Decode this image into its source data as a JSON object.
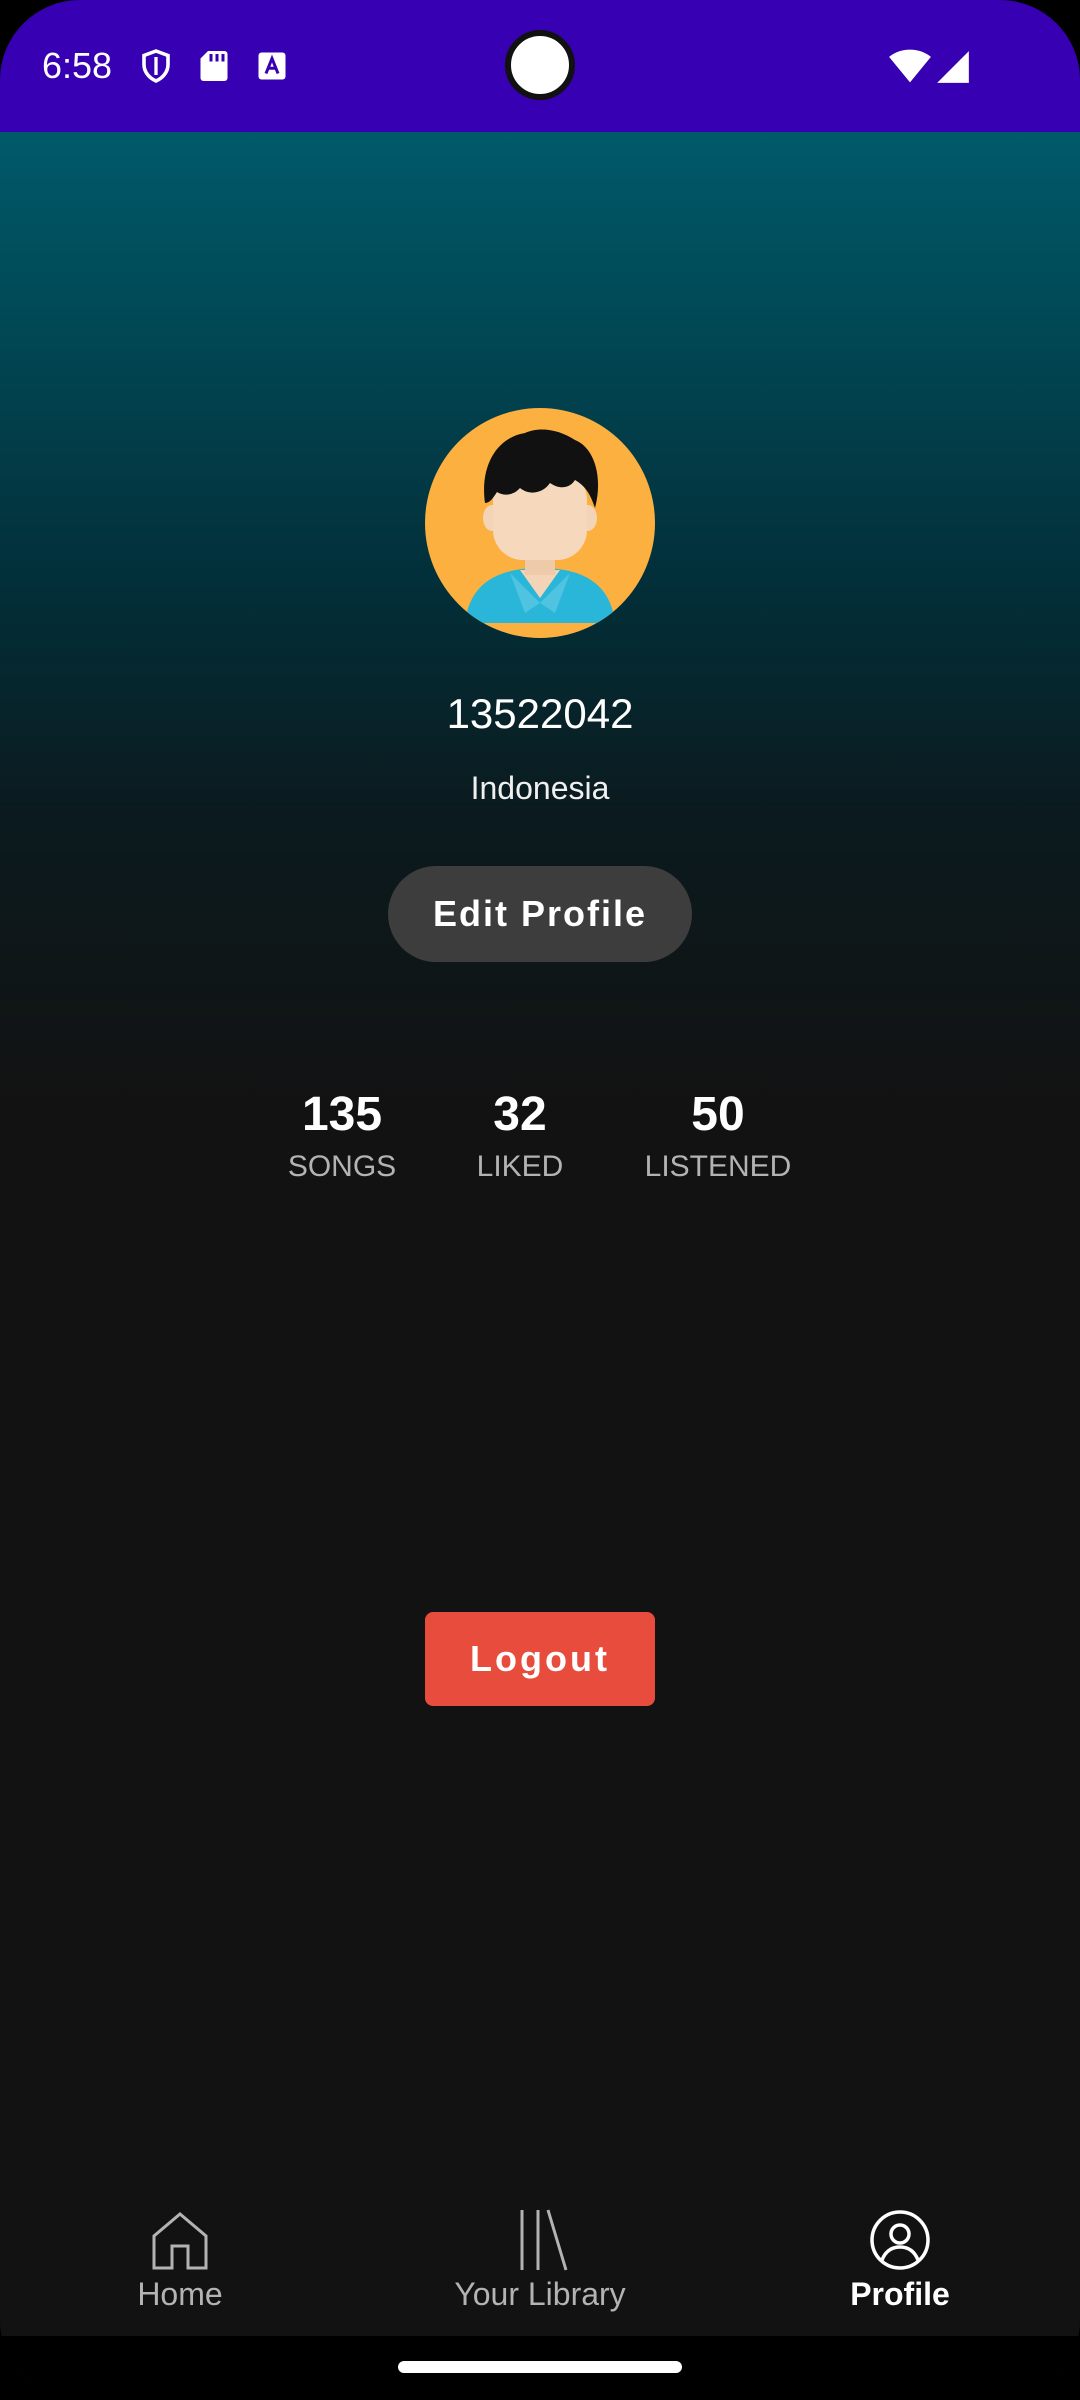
{
  "status_bar": {
    "time": "6:58",
    "background": "#3700b3",
    "icons": [
      "shield-icon",
      "sd-card-icon",
      "font-a-icon",
      "wifi-icon",
      "signal-icon"
    ]
  },
  "profile": {
    "avatar_icon": "avatar-illustration",
    "username": "13522042",
    "country": "Indonesia",
    "edit_button_label": "Edit Profile"
  },
  "stats": [
    {
      "value": "135",
      "label": "SONGS"
    },
    {
      "value": "32",
      "label": "LIKED"
    },
    {
      "value": "50",
      "label": "LISTENED"
    }
  ],
  "logout": {
    "label": "Logout",
    "color": "#e74c3c"
  },
  "bottom_nav": {
    "items": [
      {
        "label": "Home",
        "icon": "home-icon",
        "active": false
      },
      {
        "label": "Your Library",
        "icon": "library-icon",
        "active": false
      },
      {
        "label": "Profile",
        "icon": "profile-icon",
        "active": true
      }
    ]
  },
  "colors": {
    "gradient_top": "#005a6a",
    "background": "#121212",
    "edit_button_bg": "#3d3d3d"
  }
}
